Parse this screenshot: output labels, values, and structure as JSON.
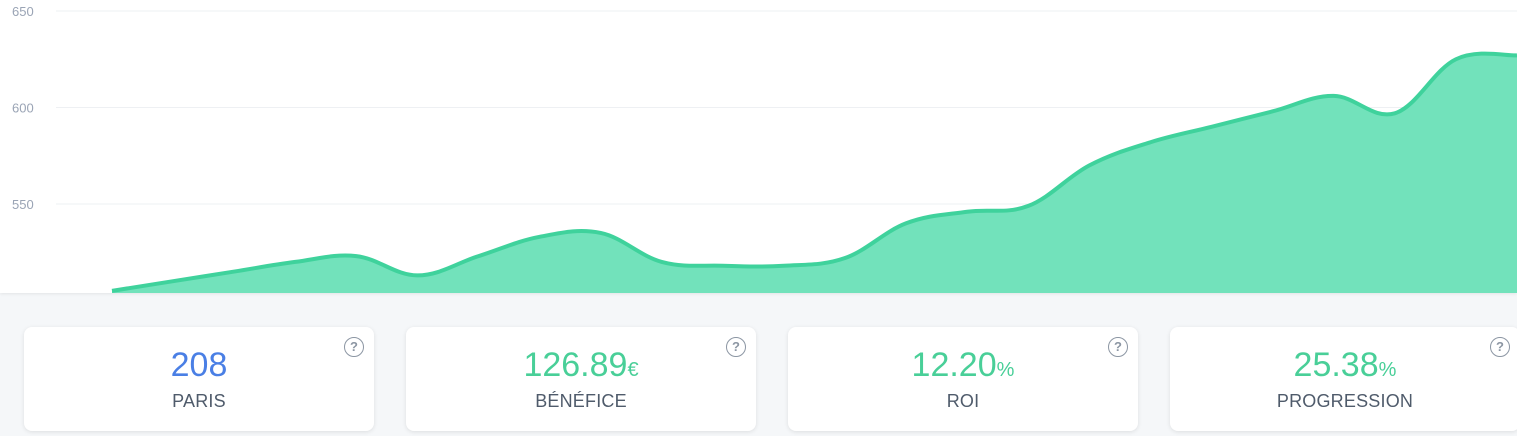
{
  "colors": {
    "area_fill": "#72e2bb",
    "area_line": "#3fd29c",
    "blue_value": "#4a7fe5",
    "green_value": "#49cf98"
  },
  "chart_data": {
    "type": "area",
    "y_ticks": [
      "650",
      "600",
      "550"
    ],
    "ylim": [
      505,
      650
    ],
    "grid": true,
    "x": [
      0,
      1,
      2,
      3,
      4,
      5,
      6,
      7,
      8,
      9,
      10,
      11,
      12,
      13,
      14,
      15,
      16,
      17,
      18,
      19,
      20,
      21,
      22,
      23
    ],
    "values": [
      505,
      510,
      515,
      520,
      523,
      513,
      523,
      533,
      535,
      520,
      518,
      518,
      522,
      540,
      546,
      549,
      570,
      582,
      590,
      598,
      606,
      597,
      625,
      627
    ]
  },
  "stats": [
    {
      "value": "208",
      "unit": "",
      "label": "PARIS",
      "help": "?"
    },
    {
      "value": "126.89",
      "unit": "€",
      "label": "BÉNÉFICE",
      "help": "?"
    },
    {
      "value": "12.20",
      "unit": "%",
      "label": "ROI",
      "help": "?"
    },
    {
      "value": "25.38",
      "unit": "%",
      "label": "PROGRESSION",
      "help": "?"
    }
  ]
}
